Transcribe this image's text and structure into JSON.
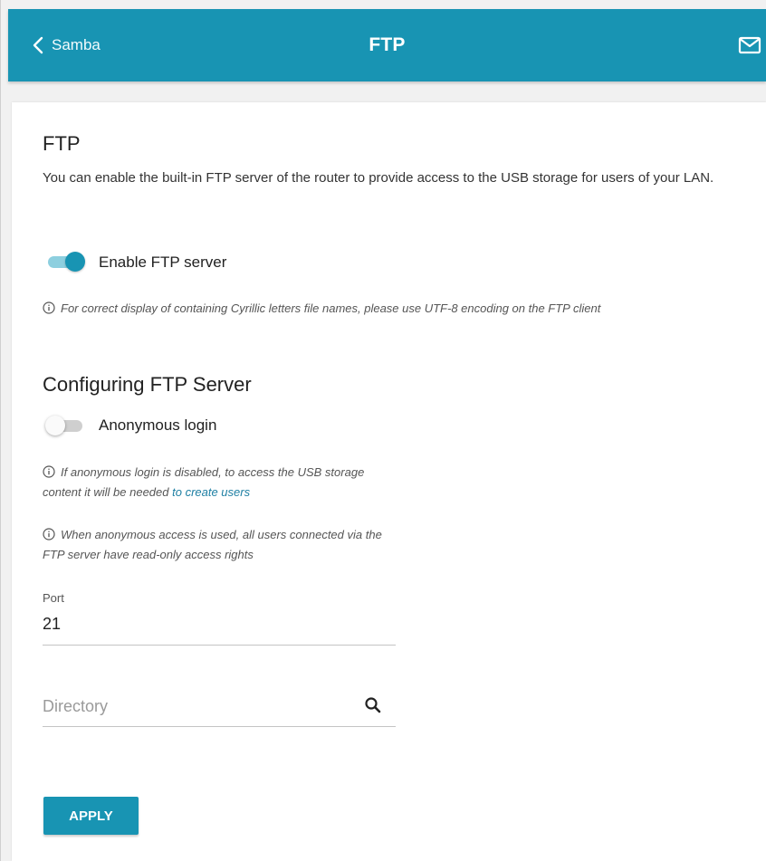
{
  "header": {
    "back_label": "Samba",
    "title": "FTP",
    "icons": {
      "back": "chevron-left-icon",
      "mail": "mail-icon"
    }
  },
  "main": {
    "section_title": "FTP",
    "description": "You can enable the built-in FTP server of the router to provide access to the USB storage for users of your LAN.",
    "enable_toggle": {
      "label": "Enable FTP server",
      "on": true
    },
    "cyrillic_hint": "For correct display of containing Cyrillic letters file names, please use UTF-8 encoding on the FTP client",
    "config_title": "Configuring FTP Server",
    "anonymous_toggle": {
      "label": "Anonymous login",
      "on": false
    },
    "anon_disabled_hint": {
      "text": "If anonymous login is disabled, to access the USB storage content it will be needed ",
      "link": "to create users"
    },
    "anon_used_hint": "When anonymous access is used, all users connected via the FTP server have read-only access rights",
    "port": {
      "label": "Port",
      "value": "21"
    },
    "directory": {
      "placeholder": "Directory",
      "icon": "search-icon"
    },
    "apply_label": "APPLY"
  },
  "colors": {
    "accent": "#1894b3",
    "toggle_track_on": "#8dcfdf",
    "link": "#1e7fa3"
  }
}
